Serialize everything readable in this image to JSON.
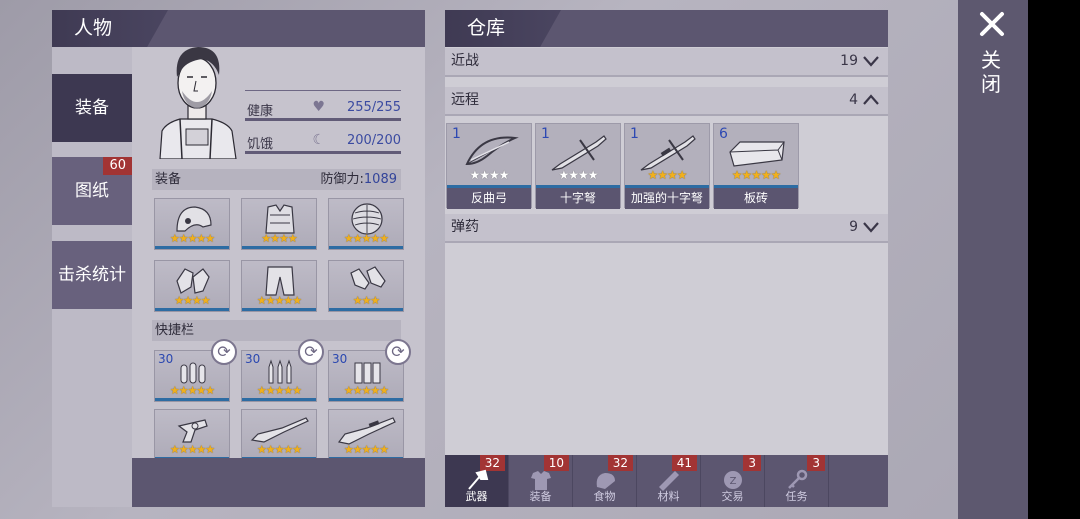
{
  "character_panel": {
    "title": "人物",
    "side_tabs": [
      {
        "label": "装备",
        "active": true
      },
      {
        "label": "图纸",
        "badge": "60"
      },
      {
        "label": "击杀统计"
      }
    ],
    "stats": {
      "health_label": "健康",
      "health_value": "255/255",
      "hunger_label": "饥饿",
      "hunger_value": "200/200"
    },
    "equipment": {
      "label": "装备",
      "defense_label": "防御力:",
      "defense_value": "1089",
      "slots": [
        {
          "item": "helmet-icon",
          "stars": 5
        },
        {
          "item": "vest-icon",
          "stars": 4
        },
        {
          "item": "backpack-icon",
          "stars": 5
        },
        {
          "item": "gloves-icon",
          "stars": 4
        },
        {
          "item": "pants-icon",
          "stars": 5
        },
        {
          "item": "shoes-icon",
          "stars": 3
        }
      ]
    },
    "quickbar": {
      "label": "快捷栏",
      "ammo_slots": [
        {
          "qty": "30",
          "stars": 5
        },
        {
          "qty": "30",
          "stars": 5
        },
        {
          "qty": "30",
          "stars": 5
        }
      ],
      "weapon_slots": [
        {
          "item": "revolver-icon",
          "stars": 5
        },
        {
          "item": "rifle-icon",
          "stars": 5
        },
        {
          "item": "shotgun-icon",
          "stars": 5
        }
      ]
    }
  },
  "warehouse": {
    "title": "仓库",
    "categories": [
      {
        "label": "近战",
        "count": "19",
        "expanded": false
      },
      {
        "label": "远程",
        "count": "4",
        "expanded": true
      },
      {
        "label": "弹药",
        "count": "9",
        "expanded": false
      }
    ],
    "ranged_items": [
      {
        "name": "反曲弓",
        "qty": "1",
        "stars": 4,
        "star_color": "white",
        "icon": "bow-icon"
      },
      {
        "name": "十字弩",
        "qty": "1",
        "stars": 4,
        "star_color": "white",
        "icon": "crossbow-icon"
      },
      {
        "name": "加强的十字弩",
        "qty": "1",
        "stars": 4,
        "star_color": "gold",
        "icon": "crossbow-icon"
      },
      {
        "name": "板砖",
        "qty": "6",
        "stars": 5,
        "star_color": "gold",
        "icon": "brick-icon"
      }
    ],
    "bottom_tabs": [
      {
        "label": "武器",
        "badge": "32",
        "active": true,
        "icon": "axe-icon"
      },
      {
        "label": "装备",
        "badge": "10",
        "icon": "shirt-icon"
      },
      {
        "label": "食物",
        "badge": "32",
        "icon": "bread-icon"
      },
      {
        "label": "材料",
        "badge": "41",
        "icon": "plank-icon"
      },
      {
        "label": "交易",
        "badge": "3",
        "icon": "coin-icon"
      },
      {
        "label": "任务",
        "badge": "3",
        "icon": "key-icon"
      }
    ]
  },
  "close": {
    "label": "关闭"
  },
  "colors": {
    "panel_dark": "#5c5670",
    "tab_active": "#3d3851",
    "badge_red": "#a23434",
    "star_gold": "#f1b01c",
    "accent_blue": "#3b4ba1",
    "slot_bar": "#2d6ca3"
  }
}
